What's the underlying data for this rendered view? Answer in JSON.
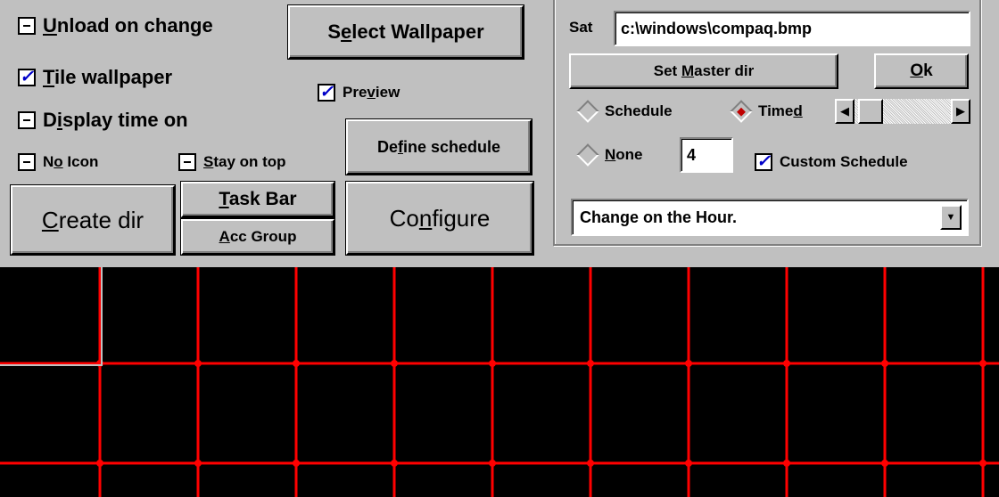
{
  "options": {
    "unload_on_change": {
      "pre": "",
      "key": "U",
      "post": "nload on change",
      "checked": false
    },
    "tile_wallpaper": {
      "pre": "",
      "key": "T",
      "post": "ile wallpaper",
      "checked": true
    },
    "display_time_on": {
      "pre": "D",
      "key": "i",
      "post": "splay time on",
      "checked": false
    },
    "no_icon": {
      "pre": "N",
      "key": "o",
      "post": " Icon",
      "checked": false
    },
    "stay_on_top": {
      "pre": "",
      "key": "S",
      "post": "tay on top",
      "checked": false
    },
    "preview": {
      "pre": "Pre",
      "key": "v",
      "post": "iew",
      "checked": true
    },
    "custom_schedule": {
      "label": "Custom Schedule",
      "checked": true
    }
  },
  "buttons": {
    "select_wallpaper": {
      "pre": "S",
      "key": "e",
      "post": "lect Wallpaper"
    },
    "define_schedule": {
      "pre": "De",
      "key": "f",
      "post": "ine schedule"
    },
    "create_dir": {
      "pre": "",
      "key": "C",
      "post": "reate dir"
    },
    "task_bar": {
      "pre": "",
      "key": "T",
      "post": "ask Bar"
    },
    "acc_group": {
      "pre": "",
      "key": "A",
      "post": "cc Group"
    },
    "configure": {
      "pre": "Co",
      "key": "n",
      "post": "figure"
    },
    "set_master_dir": {
      "pre": "Set ",
      "key": "M",
      "post": "aster dir"
    },
    "ok": {
      "pre": "",
      "key": "O",
      "post": "k"
    }
  },
  "path": {
    "label": "Sat",
    "value": "c:\\windows\\compaq.bmp"
  },
  "mode": {
    "schedule": {
      "label": "Schedule",
      "selected": false
    },
    "timed": {
      "pre": "Time",
      "key": "d",
      "post": "",
      "selected": true
    },
    "none": {
      "pre": "",
      "key": "N",
      "post": "one",
      "selected": false
    }
  },
  "interval": {
    "value": "4",
    "slider_fraction": 0.05
  },
  "schedule_combo": {
    "selected": "Change on the Hour."
  },
  "icons": {
    "scroll_left": "left-arrow-icon",
    "scroll_right": "right-arrow-icon",
    "combo_dropdown": "down-arrow-icon"
  },
  "colors": {
    "check": "#0000c8",
    "radio_dot": "#c00000",
    "preview_grid": "#ff0000",
    "preview_bg": "#000000"
  }
}
